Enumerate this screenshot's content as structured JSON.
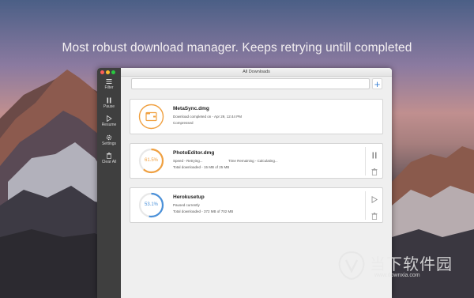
{
  "headline": "Most robust download manager. Keeps retrying untill completed",
  "window": {
    "title": "All Downloads",
    "search": {
      "value": "",
      "placeholder": ""
    },
    "add_label": "+"
  },
  "sidebar": {
    "items": [
      {
        "label": "Filter",
        "icon": "filter-icon"
      },
      {
        "label": "Pause",
        "icon": "pause-icon"
      },
      {
        "label": "Resume",
        "icon": "play-icon"
      },
      {
        "label": "Settings",
        "icon": "gear-icon"
      },
      {
        "label": "Clear All",
        "icon": "trash-icon"
      }
    ]
  },
  "downloads": [
    {
      "name": "MetaSync.dmg",
      "line1": "Download completed on - Apr 29, 12:44 PM",
      "line2": "Compressed",
      "status": "completed"
    },
    {
      "name": "PhotoEditor.dmg",
      "progress_label": "61.5%",
      "progress": 0.615,
      "ring_color": "#f0a040",
      "speed": "Speed - Retrying...",
      "time_remaining": "Time Remaining - Calculating...",
      "total": "Total downloaded - 15 MB of 25 MB",
      "status": "retrying"
    },
    {
      "name": "Herokusetup",
      "progress_label": "53.1%",
      "progress": 0.531,
      "ring_color": "#4a90d9",
      "line1": "Paused currently",
      "total": "Total downloaded - 372 MB of 702 MB",
      "status": "paused"
    }
  ],
  "watermark": {
    "text": "当下软件园",
    "url": "www.downxia.com"
  },
  "colors": {
    "accent_blue": "#3b82d6",
    "ring_orange": "#f0a040",
    "ring_blue": "#4a90d9",
    "sidebar_bg": "#3f3f3f"
  }
}
